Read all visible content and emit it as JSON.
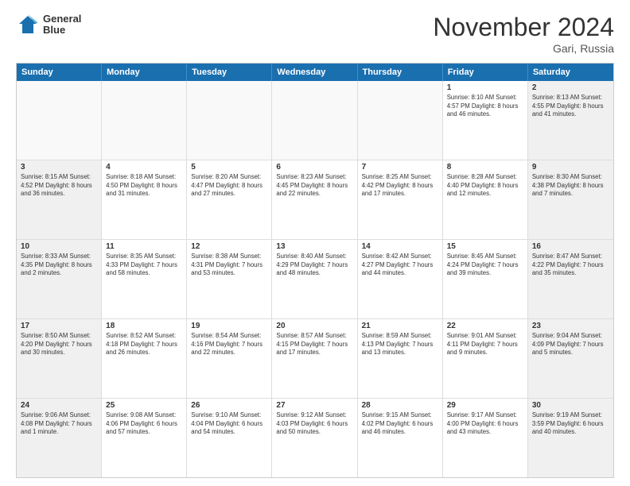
{
  "logo": {
    "line1": "General",
    "line2": "Blue"
  },
  "title": "November 2024",
  "location": "Gari, Russia",
  "weekdays": [
    "Sunday",
    "Monday",
    "Tuesday",
    "Wednesday",
    "Thursday",
    "Friday",
    "Saturday"
  ],
  "rows": [
    [
      {
        "day": "",
        "detail": "",
        "empty": true
      },
      {
        "day": "",
        "detail": "",
        "empty": true
      },
      {
        "day": "",
        "detail": "",
        "empty": true
      },
      {
        "day": "",
        "detail": "",
        "empty": true
      },
      {
        "day": "",
        "detail": "",
        "empty": true
      },
      {
        "day": "1",
        "detail": "Sunrise: 8:10 AM\nSunset: 4:57 PM\nDaylight: 8 hours\nand 46 minutes."
      },
      {
        "day": "2",
        "detail": "Sunrise: 8:13 AM\nSunset: 4:55 PM\nDaylight: 8 hours\nand 41 minutes."
      }
    ],
    [
      {
        "day": "3",
        "detail": "Sunrise: 8:15 AM\nSunset: 4:52 PM\nDaylight: 8 hours\nand 36 minutes."
      },
      {
        "day": "4",
        "detail": "Sunrise: 8:18 AM\nSunset: 4:50 PM\nDaylight: 8 hours\nand 31 minutes."
      },
      {
        "day": "5",
        "detail": "Sunrise: 8:20 AM\nSunset: 4:47 PM\nDaylight: 8 hours\nand 27 minutes."
      },
      {
        "day": "6",
        "detail": "Sunrise: 8:23 AM\nSunset: 4:45 PM\nDaylight: 8 hours\nand 22 minutes."
      },
      {
        "day": "7",
        "detail": "Sunrise: 8:25 AM\nSunset: 4:42 PM\nDaylight: 8 hours\nand 17 minutes."
      },
      {
        "day": "8",
        "detail": "Sunrise: 8:28 AM\nSunset: 4:40 PM\nDaylight: 8 hours\nand 12 minutes."
      },
      {
        "day": "9",
        "detail": "Sunrise: 8:30 AM\nSunset: 4:38 PM\nDaylight: 8 hours\nand 7 minutes."
      }
    ],
    [
      {
        "day": "10",
        "detail": "Sunrise: 8:33 AM\nSunset: 4:35 PM\nDaylight: 8 hours\nand 2 minutes."
      },
      {
        "day": "11",
        "detail": "Sunrise: 8:35 AM\nSunset: 4:33 PM\nDaylight: 7 hours\nand 58 minutes."
      },
      {
        "day": "12",
        "detail": "Sunrise: 8:38 AM\nSunset: 4:31 PM\nDaylight: 7 hours\nand 53 minutes."
      },
      {
        "day": "13",
        "detail": "Sunrise: 8:40 AM\nSunset: 4:29 PM\nDaylight: 7 hours\nand 48 minutes."
      },
      {
        "day": "14",
        "detail": "Sunrise: 8:42 AM\nSunset: 4:27 PM\nDaylight: 7 hours\nand 44 minutes."
      },
      {
        "day": "15",
        "detail": "Sunrise: 8:45 AM\nSunset: 4:24 PM\nDaylight: 7 hours\nand 39 minutes."
      },
      {
        "day": "16",
        "detail": "Sunrise: 8:47 AM\nSunset: 4:22 PM\nDaylight: 7 hours\nand 35 minutes."
      }
    ],
    [
      {
        "day": "17",
        "detail": "Sunrise: 8:50 AM\nSunset: 4:20 PM\nDaylight: 7 hours\nand 30 minutes."
      },
      {
        "day": "18",
        "detail": "Sunrise: 8:52 AM\nSunset: 4:18 PM\nDaylight: 7 hours\nand 26 minutes."
      },
      {
        "day": "19",
        "detail": "Sunrise: 8:54 AM\nSunset: 4:16 PM\nDaylight: 7 hours\nand 22 minutes."
      },
      {
        "day": "20",
        "detail": "Sunrise: 8:57 AM\nSunset: 4:15 PM\nDaylight: 7 hours\nand 17 minutes."
      },
      {
        "day": "21",
        "detail": "Sunrise: 8:59 AM\nSunset: 4:13 PM\nDaylight: 7 hours\nand 13 minutes."
      },
      {
        "day": "22",
        "detail": "Sunrise: 9:01 AM\nSunset: 4:11 PM\nDaylight: 7 hours\nand 9 minutes."
      },
      {
        "day": "23",
        "detail": "Sunrise: 9:04 AM\nSunset: 4:09 PM\nDaylight: 7 hours\nand 5 minutes."
      }
    ],
    [
      {
        "day": "24",
        "detail": "Sunrise: 9:06 AM\nSunset: 4:08 PM\nDaylight: 7 hours\nand 1 minute."
      },
      {
        "day": "25",
        "detail": "Sunrise: 9:08 AM\nSunset: 4:06 PM\nDaylight: 6 hours\nand 57 minutes."
      },
      {
        "day": "26",
        "detail": "Sunrise: 9:10 AM\nSunset: 4:04 PM\nDaylight: 6 hours\nand 54 minutes."
      },
      {
        "day": "27",
        "detail": "Sunrise: 9:12 AM\nSunset: 4:03 PM\nDaylight: 6 hours\nand 50 minutes."
      },
      {
        "day": "28",
        "detail": "Sunrise: 9:15 AM\nSunset: 4:02 PM\nDaylight: 6 hours\nand 46 minutes."
      },
      {
        "day": "29",
        "detail": "Sunrise: 9:17 AM\nSunset: 4:00 PM\nDaylight: 6 hours\nand 43 minutes."
      },
      {
        "day": "30",
        "detail": "Sunrise: 9:19 AM\nSunset: 3:59 PM\nDaylight: 6 hours\nand 40 minutes."
      }
    ]
  ]
}
